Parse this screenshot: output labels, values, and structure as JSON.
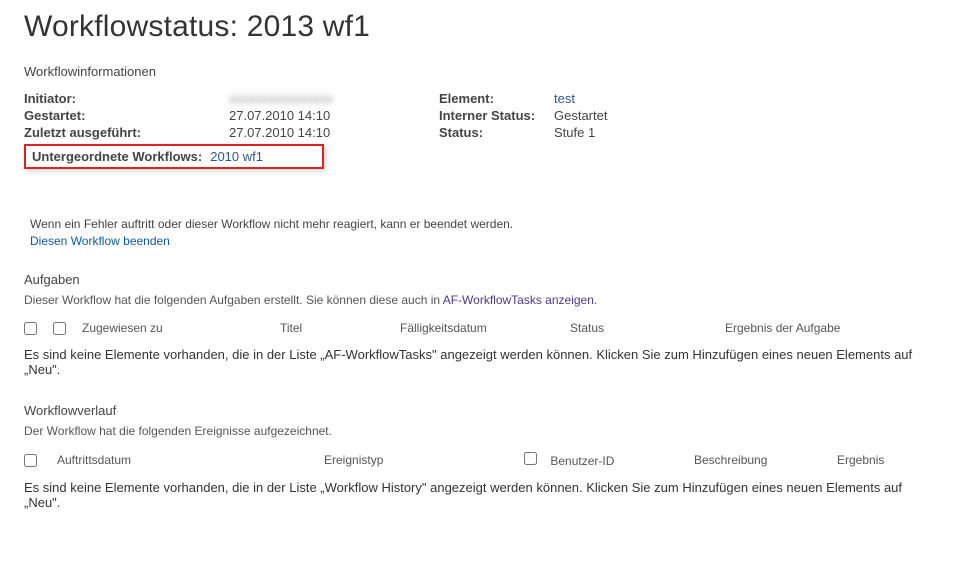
{
  "page": {
    "title": "Workflowstatus: 2013 wf1"
  },
  "info": {
    "heading": "Workflowinformationen",
    "left_labels": {
      "initiator": "Initiator:",
      "started": "Gestartet:",
      "last_run": "Zuletzt ausgeführt:"
    },
    "left_values": {
      "initiator": "xxxxxxxxxxxxxxxx",
      "started": "27.07.2010 14:10",
      "last_run": "27.07.2010 14:10"
    },
    "right_labels": {
      "element": "Element:",
      "internal_status": "Interner Status:",
      "status": "Status:"
    },
    "right_values": {
      "element": "test",
      "internal_status": "Gestartet",
      "status": "Stufe 1"
    },
    "highlight": {
      "label": "Untergeordnete Workflows:",
      "link": "2010 wf1"
    }
  },
  "error_block": {
    "text": "Wenn ein Fehler auftritt oder dieser Workflow nicht mehr reagiert, kann er beendet werden.",
    "link": "Diesen Workflow beenden"
  },
  "tasks": {
    "heading": "Aufgaben",
    "desc_prefix": "Dieser Workflow hat die folgenden Aufgaben erstellt. Sie können diese auch in ",
    "desc_link": "AF-WorkflowTasks anzeigen",
    "desc_suffix": ".",
    "columns": {
      "assigned": "Zugewiesen zu",
      "title": "Titel",
      "due": "Fälligkeitsdatum",
      "status": "Status",
      "outcome": "Ergebnis der Aufgabe"
    },
    "empty": "Es sind keine Elemente vorhanden, die in der Liste „AF-WorkflowTasks\" angezeigt werden können. Klicken Sie zum Hinzufügen eines neuen Elements auf „Neu\"."
  },
  "history": {
    "heading": "Workflowverlauf",
    "desc": "Der Workflow hat die folgenden Ereignisse aufgezeichnet.",
    "columns": {
      "date": "Auftrittsdatum",
      "event_type": "Ereignistyp",
      "user_id": "Benutzer-ID",
      "description": "Beschreibung",
      "result": "Ergebnis"
    },
    "empty": "Es sind keine Elemente vorhanden, die in der Liste „Workflow History\" angezeigt werden können. Klicken Sie zum Hinzufügen eines neuen Elements auf „Neu\"."
  }
}
